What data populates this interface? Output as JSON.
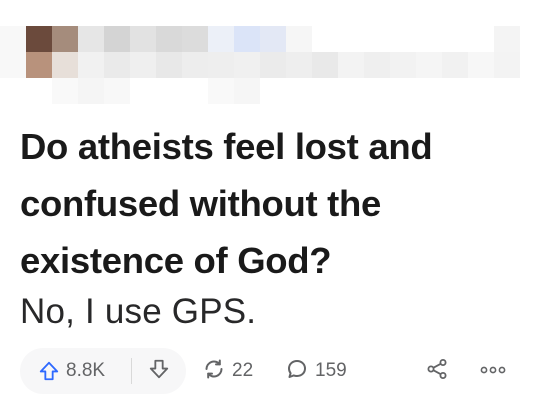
{
  "post": {
    "question": "Do atheists feel lost and confused without the existence of God?",
    "answer": "No, I use GPS."
  },
  "actions": {
    "upvotes": "8.8K",
    "shares": "22",
    "comments": "159"
  },
  "colors": {
    "upvote_accent": "#2e69ff",
    "icon_gray": "#636466",
    "pill_bg": "#f7f7f8"
  },
  "icons": {
    "upvote": "upvote-arrow-icon",
    "downvote": "downvote-arrow-icon",
    "share": "reshare-icon",
    "comment": "comment-bubble-icon",
    "share_network": "share-icon",
    "more": "more-dots-icon"
  }
}
